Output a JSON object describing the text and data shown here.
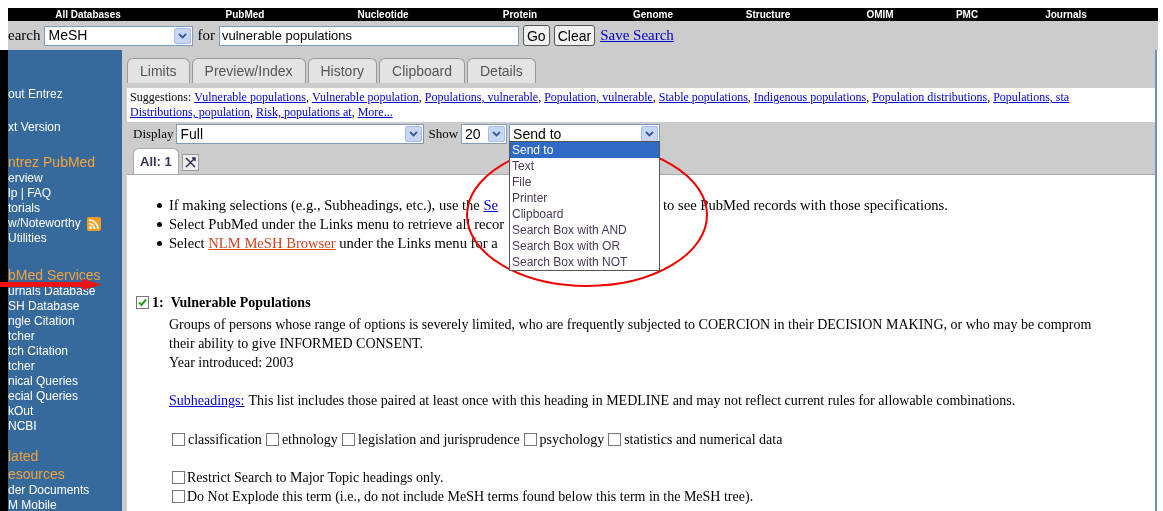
{
  "top_nav": [
    "All Databases",
    "PubMed",
    "Nucleotide",
    "Protein",
    "Genome",
    "Structure",
    "OMIM",
    "PMC",
    "Journals"
  ],
  "search_bar": {
    "label": "earch",
    "database": "MeSH",
    "for_label": "for",
    "query": "vulnerable populations",
    "buttons": [
      "Go",
      "Clear"
    ],
    "save_link": "Save Search"
  },
  "sidebar": {
    "top_links": [
      "out Entrez",
      "xt Version"
    ],
    "sections": [
      {
        "heading": [
          "ntrez PubMed"
        ],
        "items": [
          {
            "label": "erview",
            "feed": false
          },
          {
            "label": "lp | FAQ",
            "feed": false
          },
          {
            "label": "torials",
            "feed": false
          },
          {
            "label": "w/Noteworthy",
            "feed": true
          },
          {
            "label": "Utilities",
            "feed": false
          }
        ]
      },
      {
        "heading": [
          "bMed Services"
        ],
        "items": [
          {
            "label": "urnals Database",
            "feed": false
          },
          {
            "label": "SH Database",
            "feed": false
          },
          {
            "label": "ngle Citation",
            "feed": false
          },
          {
            "label": "tcher",
            "feed": false
          },
          {
            "label": "tch Citation",
            "feed": false
          },
          {
            "label": "tcher",
            "feed": false
          },
          {
            "label": "nical Queries",
            "feed": false
          },
          {
            "label": "ecial Queries",
            "feed": false
          },
          {
            "label": "kOut",
            "feed": false
          },
          {
            "label": "NCBI",
            "feed": false
          }
        ]
      },
      {
        "heading": [
          "lated",
          "esources"
        ],
        "items": [
          {
            "label": "der Documents",
            "feed": false
          },
          {
            "label": "M Mobile",
            "feed": false
          }
        ]
      }
    ]
  },
  "tabs": [
    {
      "label": "Limits",
      "selected": false
    },
    {
      "label": "Preview/Index",
      "selected": false
    },
    {
      "label": "History",
      "selected": false
    },
    {
      "label": "Clipboard",
      "selected": false
    },
    {
      "label": "Details",
      "selected": false
    }
  ],
  "suggestions": {
    "label": "Suggestions:",
    "separator": ",",
    "lines": [
      [
        "Vulnerable populations",
        "Vulnerable population",
        "Populations, vulnerable",
        "Population, vulnerable",
        "Stable populations",
        "Indigenous populations",
        "Population distributions",
        "Populations, sta"
      ],
      [
        "Distributions, population",
        "Risk, populations at",
        "More..."
      ]
    ]
  },
  "display": {
    "label": "Display",
    "value": "Full"
  },
  "show": {
    "label": "Show",
    "value": "20"
  },
  "send_to": {
    "value": "Send to",
    "options": [
      {
        "label": "Send to",
        "selected": true
      },
      {
        "label": "Text",
        "selected": false
      },
      {
        "label": "File",
        "selected": false
      },
      {
        "label": "Printer",
        "selected": false
      },
      {
        "label": "Clipboard",
        "selected": false
      },
      {
        "label": "Search Box with AND",
        "selected": false
      },
      {
        "label": "Search Box with OR",
        "selected": false
      },
      {
        "label": "Search Box with NOT",
        "selected": false
      }
    ]
  },
  "result_tab": {
    "label": "All: 1",
    "selected": true
  },
  "bullets": [
    {
      "left": [
        {
          "kind": "text",
          "text": "If making selections (e.g., Subheadings, etc.), use the "
        },
        {
          "kind": "link",
          "text": "Se"
        }
      ],
      "right": "to see PubMed records with those specifications."
    },
    {
      "left": [
        {
          "kind": "text",
          "text": "Select PubMed under the Links menu to retrieve all recor"
        }
      ]
    },
    {
      "left": [
        {
          "kind": "text",
          "text": "Select "
        },
        {
          "kind": "visited_link",
          "text": "NLM MeSH Browser"
        },
        {
          "kind": "text",
          "text": " under the Links menu for a"
        }
      ]
    }
  ],
  "record": {
    "checked": true,
    "number": "1:",
    "title": "Vulnerable Populations",
    "description": [
      "Groups of persons whose range of options is severely limited, who are frequently subjected to COERCION in their DECISION MAKING, or who may be comprom",
      "their ability to give INFORMED CONSENT.",
      "Year introduced: 2003"
    ],
    "subheadings_link": "Subheadings:",
    "subheadings_note": "This list includes those paired at least once with this heading in MEDLINE and may not reflect current rules for allowable combinations.",
    "subheading_options": [
      {
        "label": "classification",
        "checked": false
      },
      {
        "label": "ethnology",
        "checked": false
      },
      {
        "label": "legislation and jurisprudence",
        "checked": false
      },
      {
        "label": "psychology",
        "checked": false
      },
      {
        "label": "statistics and numerical data",
        "checked": false
      }
    ],
    "options": [
      {
        "label": "Restrict Search to Major Topic headings only.",
        "checked": false
      },
      {
        "label": "Do Not Explode this term (i.e., do not include MeSH terms found below this term in the MeSH tree).",
        "checked": false
      }
    ]
  }
}
